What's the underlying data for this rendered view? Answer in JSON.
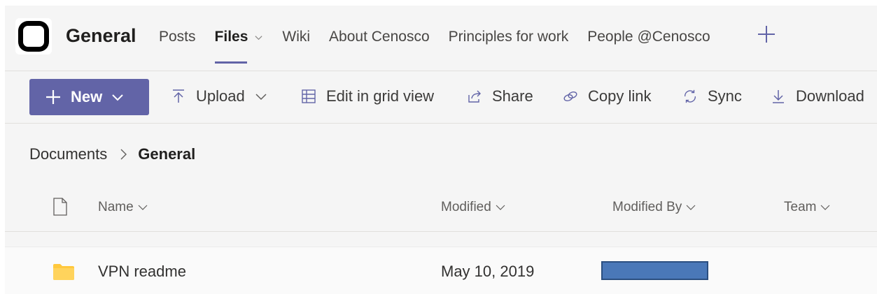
{
  "header": {
    "channel_title": "General",
    "tabs": [
      {
        "label": "Posts",
        "active": false
      },
      {
        "label": "Files",
        "active": true
      },
      {
        "label": "Wiki",
        "active": false
      },
      {
        "label": "About Cenosco",
        "active": false
      },
      {
        "label": "Principles for work",
        "active": false
      },
      {
        "label": "People @Cenosco",
        "active": false
      }
    ],
    "add_tab_icon": "plus-icon"
  },
  "toolbar": {
    "new_label": "New",
    "upload_label": "Upload",
    "edit_grid_label": "Edit in grid view",
    "share_label": "Share",
    "copy_link_label": "Copy link",
    "sync_label": "Sync",
    "download_label": "Download"
  },
  "breadcrumb": {
    "root": "Documents",
    "current": "General"
  },
  "table": {
    "columns": [
      "Name",
      "Modified",
      "Modified By",
      "Team"
    ],
    "rows": [
      {
        "name": "VPN readme",
        "modified": "May 10, 2019",
        "modified_by": "",
        "type_icon": "folder-icon"
      }
    ]
  },
  "colors": {
    "accent": "#6264a7",
    "folder": "#ffc83d",
    "redaction": "#4a78b8"
  }
}
